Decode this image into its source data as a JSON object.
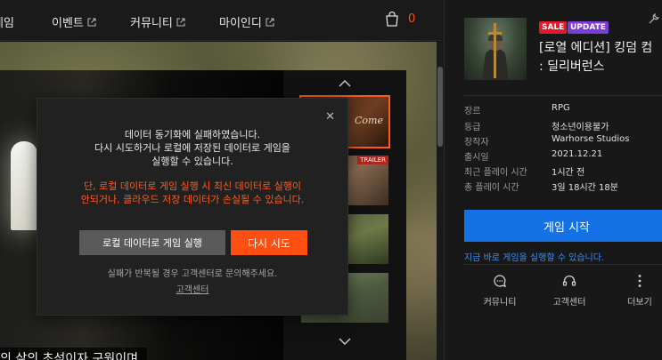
{
  "nav": {
    "items": [
      {
        "label": "게임",
        "external": false
      },
      {
        "label": "이벤트",
        "external": true
      },
      {
        "label": "커뮤니티",
        "external": true
      },
      {
        "label": "마이인디",
        "external": true
      }
    ],
    "cart_count": "0"
  },
  "media": {
    "subtitle": "의 삶의 초석이자 구원이며,",
    "thumbnails": [
      {
        "overlay": "Come",
        "badge": ""
      },
      {
        "overlay": "on",
        "badge": "TRAILER"
      },
      {
        "overlay": "",
        "badge": ""
      },
      {
        "overlay": "",
        "badge": ""
      }
    ]
  },
  "modal": {
    "line1": "데이터 동기화에 실패하였습니다.",
    "line2": "다시 시도하거나 로컬에 저장된 데이터로 게임을",
    "line3": "실행할 수 있습니다.",
    "warn1": "단, 로컬 데이터로 게임 실행 시 최신 데이터로 실행이",
    "warn2": "안되거나, 클라우드 저장 데이터가 손실될 수 있습니다.",
    "local_button": "로컬 데이터로 게임 실행",
    "retry_button": "다시 시도",
    "help_text": "실패가 반복될 경우 고객센터로 문의해주세요.",
    "support_link": "고객센터"
  },
  "panel": {
    "tags": {
      "sale": "SALE",
      "update": "UPDATE"
    },
    "title_line1": "[로열 에디션] 킹덤 컴",
    "title_line2": ": 딜리버런스",
    "info": [
      {
        "key": "장르",
        "value": "RPG"
      },
      {
        "key": "등급",
        "value": "청소년이용불가"
      },
      {
        "key": "창작자",
        "value": "Warhorse Studios"
      },
      {
        "key": "출시일",
        "value": "2021.12.21"
      },
      {
        "key": "최근 플레이 시간",
        "value": "1시간 전"
      },
      {
        "key": "총 플레이 시간",
        "value": "3일 18시간 18분"
      }
    ],
    "play_button": "게임 시작",
    "play_note": "지금 바로 게임을 실행할 수 있습니다.",
    "bottom_buttons": [
      {
        "label": "커뮤니티",
        "icon": "chat-icon"
      },
      {
        "label": "고객센터",
        "icon": "headset-icon"
      },
      {
        "label": "더보기",
        "icon": "more-vertical-icon"
      }
    ]
  },
  "colors": {
    "accent_orange": "#ff4e12",
    "play_blue": "#1472e6",
    "sale_red": "#e0192d",
    "update_purple": "#7b3bd6"
  }
}
